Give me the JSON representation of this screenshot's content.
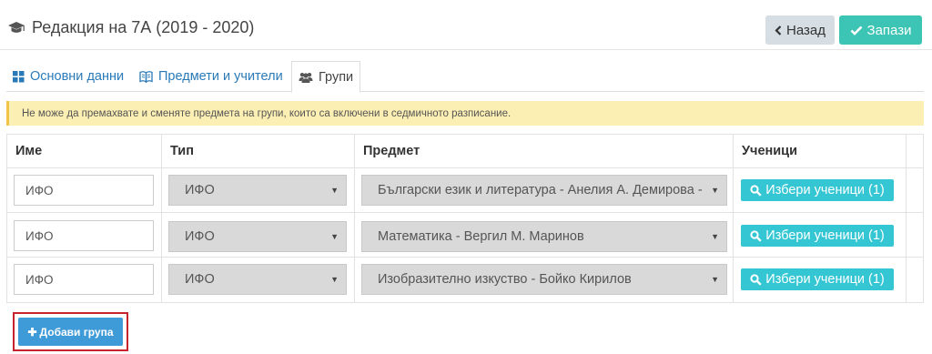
{
  "header": {
    "title": "Редакция на 7А (2019 - 2020)",
    "back_label": "Назад",
    "save_label": "Запази"
  },
  "tabs": [
    {
      "label": "Основни данни",
      "icon": "grid-icon"
    },
    {
      "label": "Предмети и учители",
      "icon": "book-icon"
    },
    {
      "label": "Групи",
      "icon": "users-icon"
    }
  ],
  "alert": "Не може да премахвате и сменяте предмета на групи, които са включени в седмичното разписание.",
  "table": {
    "columns": [
      "Име",
      "Тип",
      "Предмет",
      "Ученици"
    ],
    "rows": [
      {
        "name": "ИФО",
        "type": "ИФО",
        "subject": "Български език и литература - Анелия А. Демирова -",
        "students": "Избери ученици (1)"
      },
      {
        "name": "ИФО",
        "type": "ИФО",
        "subject": "Математика - Вергил М. Маринов",
        "students": "Избери ученици (1)"
      },
      {
        "name": "ИФО",
        "type": "ИФО",
        "subject": "Изобразително изкуство - Бойко Кирилов",
        "students": "Избери ученици (1)"
      }
    ]
  },
  "add_group_label": "Добави група",
  "colors": {
    "save": "#3cc4b4",
    "back": "#d6dee3",
    "alert_bg": "#fcefb4",
    "pick_button": "#35c6d4",
    "add_button": "#3f9ad8",
    "highlight": "#c8232c"
  }
}
